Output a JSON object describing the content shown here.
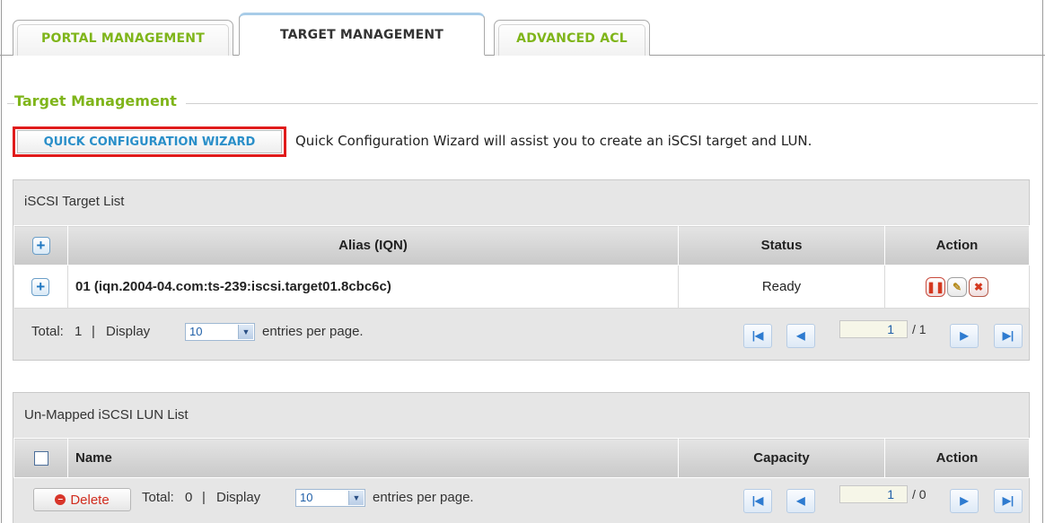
{
  "tabs": [
    {
      "label": "PORTAL MANAGEMENT",
      "active": false
    },
    {
      "label": "TARGET MANAGEMENT",
      "active": true
    },
    {
      "label": "ADVANCED ACL",
      "active": false
    }
  ],
  "section": {
    "title": "Target Management"
  },
  "wizard": {
    "button_label": "QUICK CONFIGURATION WIZARD",
    "description": "Quick Configuration Wizard will assist you to create an iSCSI target and LUN."
  },
  "target_list": {
    "title": "iSCSI Target List",
    "columns": {
      "alias": "Alias (IQN)",
      "status": "Status",
      "action": "Action"
    },
    "rows": [
      {
        "alias": "01 (iqn.2004-04.com:ts-239:iscsi.target01.8cbc6c)",
        "status": "Ready"
      }
    ],
    "footer": {
      "total_prefix": "Total:",
      "total": "1",
      "separator": "|",
      "display_label": "Display",
      "page_size": "10",
      "entries_label": "entries per page.",
      "page": "1",
      "page_total": "/ 1"
    }
  },
  "lun_list": {
    "title": "Un-Mapped iSCSI LUN List",
    "columns": {
      "name": "Name",
      "capacity": "Capacity",
      "action": "Action"
    },
    "footer": {
      "delete_label": "Delete",
      "total_prefix": "Total:",
      "total": "0",
      "separator": "|",
      "display_label": "Display",
      "page_size": "10",
      "entries_label": "entries per page.",
      "page": "1",
      "page_total": "/ 0"
    }
  },
  "colors": {
    "tab_text": "#7fb51a",
    "wizard_text": "#2a8fc9",
    "highlight_border": "#e01b1b",
    "panel_bg": "#e6e6e6"
  }
}
